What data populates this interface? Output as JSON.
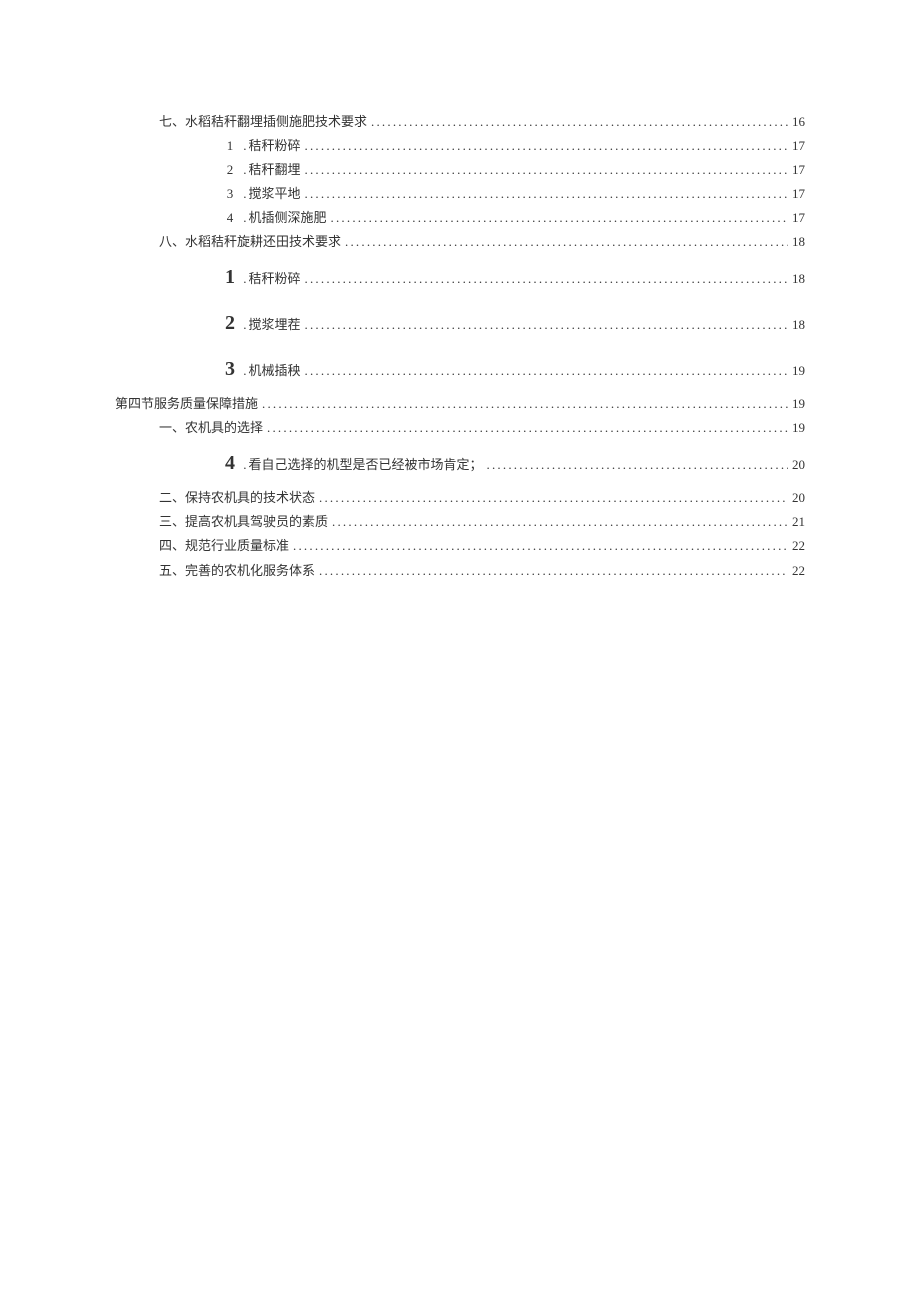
{
  "toc": {
    "items": [
      {
        "indent": 1,
        "label": "七、水稻秸秆翻埋插侧施肥技术要求",
        "page": "16",
        "style": "plain"
      },
      {
        "indent": 2,
        "num": "1",
        "numStyle": "small",
        "label": "秸秆粉碎",
        "page": "17",
        "style": "num"
      },
      {
        "indent": 2,
        "num": "2",
        "numStyle": "small",
        "label": "秸秆翻埋",
        "page": "17",
        "style": "num"
      },
      {
        "indent": 2,
        "num": "3",
        "numStyle": "small",
        "label": "搅浆平地",
        "page": "17",
        "style": "num"
      },
      {
        "indent": 2,
        "num": "4",
        "numStyle": "small",
        "label": "机插侧深施肥",
        "page": "17",
        "style": "num"
      },
      {
        "indent": 1,
        "label": "八、水稻秸秆旋耕还田技术要求",
        "page": "18",
        "style": "plain"
      },
      {
        "indent": 2,
        "num": "1",
        "numStyle": "big",
        "label": "秸秆粉碎",
        "page": "18",
        "style": "num",
        "tall": true
      },
      {
        "indent": 2,
        "num": "2",
        "numStyle": "big",
        "label": "搅浆埋茬",
        "page": "18",
        "style": "num",
        "tall": true
      },
      {
        "indent": 2,
        "num": "3",
        "numStyle": "big",
        "label": "机械插秧",
        "page": "19",
        "style": "num",
        "tall": true
      },
      {
        "indent": 0,
        "label": "第四节服务质量保障措施",
        "page": "19",
        "style": "plain"
      },
      {
        "indent": 1,
        "label": "一、农机具的选择",
        "page": "19",
        "style": "plain"
      },
      {
        "indent": 2,
        "num": "4",
        "numStyle": "big",
        "label": "看自己选择的机型是否已经被市场肯定；",
        "page": "20",
        "style": "num",
        "tall": true
      },
      {
        "indent": 1,
        "label": "二、保持农机具的技术状态",
        "page": "20",
        "style": "plain"
      },
      {
        "indent": 1,
        "label": "三、提高农机具驾驶员的素质",
        "page": "21",
        "style": "plain"
      },
      {
        "indent": 1,
        "label": "四、规范行业质量标准",
        "page": "22",
        "style": "plain"
      },
      {
        "indent": 1,
        "label": "五、完善的农机化服务体系",
        "page": "22",
        "style": "plain"
      }
    ]
  }
}
